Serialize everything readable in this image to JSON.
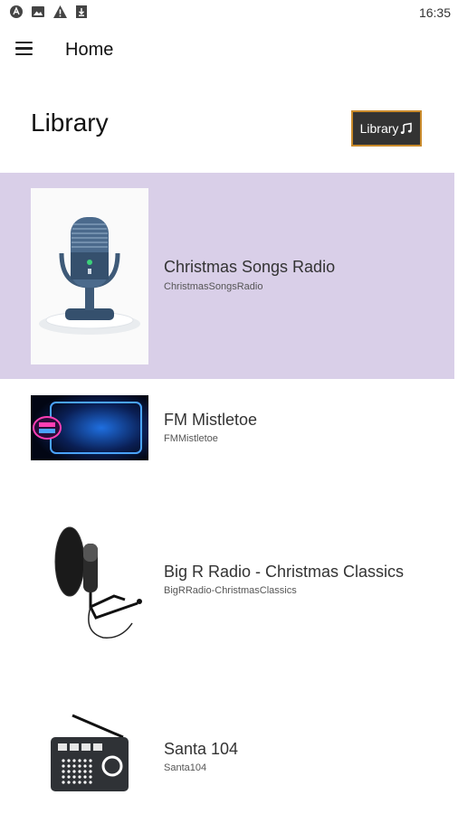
{
  "status_bar": {
    "time": "16:35",
    "icons": [
      "app-notification-icon",
      "image-icon",
      "warning-icon",
      "download-icon"
    ]
  },
  "app_bar": {
    "menu_icon": "hamburger-menu-icon",
    "title": "Home"
  },
  "library": {
    "heading": "Library",
    "button_label": "Library",
    "button_icon": "music-note-icon"
  },
  "stations": [
    {
      "name": "Christmas Songs Radio",
      "id": "ChristmasSongsRadio",
      "thumbnail": "microphone-podium-image",
      "selected": true
    },
    {
      "name": "FM Mistletoe",
      "id": "FMMistletoe",
      "thumbnail": "on-air-neon-image",
      "selected": false
    },
    {
      "name": "Big R Radio - Christmas Classics",
      "id": "BigRRadio-ChristmasClassics",
      "thumbnail": "studio-microphone-image",
      "selected": false
    },
    {
      "name": "Santa 104",
      "id": "Santa104",
      "thumbnail": "radio-icon-image",
      "selected": false
    }
  ],
  "colors": {
    "selected_row": "#d9cfe8",
    "button_bg": "#333333",
    "button_border": "#c98a2b"
  }
}
